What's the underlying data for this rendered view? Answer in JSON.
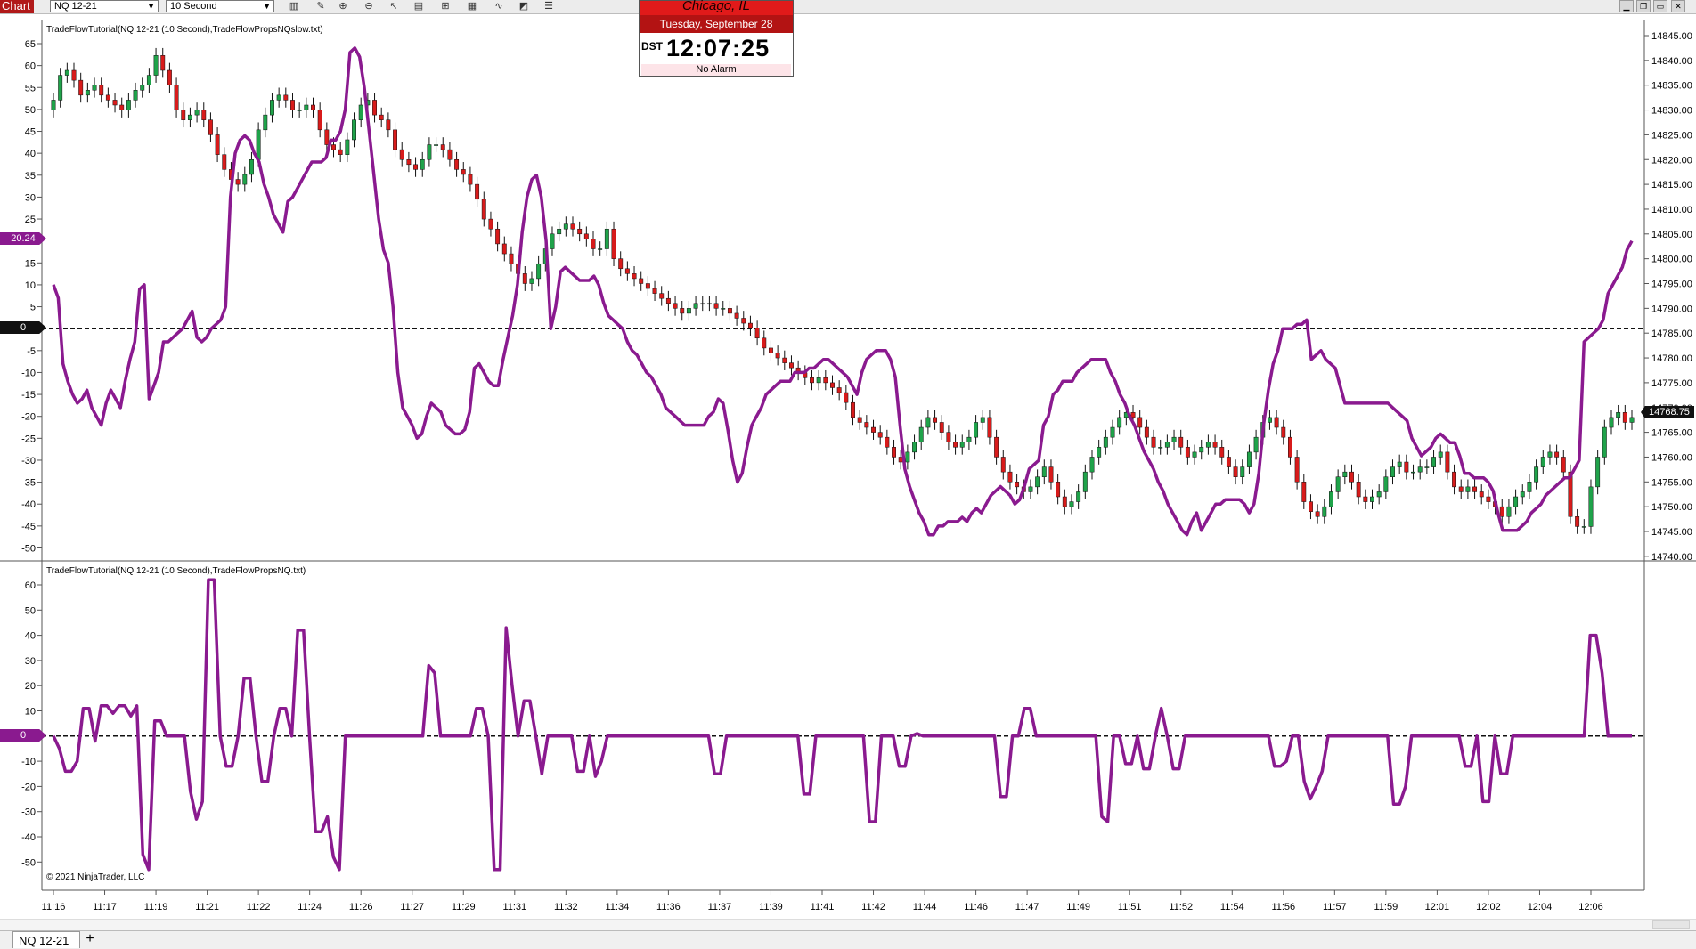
{
  "toolbar": {
    "chart_label": "Chart",
    "instrument": "NQ 12-21",
    "interval": "10 Second",
    "icons": [
      "bars-icon",
      "pencil-icon",
      "zoom-in-icon",
      "zoom-out-icon",
      "pointer-icon",
      "data-box-icon",
      "properties-icon",
      "strategies-icon",
      "indicators-icon",
      "drawing-objects-icon",
      "list-icon"
    ]
  },
  "clock": {
    "city": "Chicago, IL",
    "date": "Tuesday, September 28",
    "dst": "DST",
    "time": "12:07:25",
    "alarm": "No Alarm"
  },
  "panel1": {
    "title": "TradeFlowTutorial(NQ 12-21 (10 Second),TradeFlowPropsNQslow.txt)",
    "left_ticks": [
      "65",
      "60",
      "55",
      "50",
      "45",
      "40",
      "35",
      "30",
      "25",
      "20",
      "15",
      "10",
      "5",
      "0",
      "-5",
      "-10",
      "-15",
      "-20",
      "-25",
      "-30",
      "-35",
      "-40",
      "-45",
      "-50"
    ],
    "right_ticks": [
      "14845.00",
      "14840.00",
      "14835.00",
      "14830.00",
      "14825.00",
      "14820.00",
      "14815.00",
      "14810.00",
      "14805.00",
      "14800.00",
      "14795.00",
      "14790.00",
      "14785.00",
      "14780.00",
      "14775.00",
      "14770.00",
      "14765.00",
      "14760.00",
      "14755.00",
      "14750.00",
      "14745.00",
      "14740.00"
    ],
    "indicator_tag": "20.24",
    "zero_tag": "0",
    "price_tag": "14768.75"
  },
  "panel2": {
    "title": "TradeFlowTutorial(NQ 12-21 (10 Second),TradeFlowPropsNQ.txt)",
    "left_ticks": [
      "60",
      "50",
      "40",
      "30",
      "20",
      "10",
      "0",
      "-10",
      "-20",
      "-30",
      "-40",
      "-50"
    ],
    "zero_tag": "0",
    "copyright": "© 2021 NinjaTrader, LLC"
  },
  "time_axis": [
    "11:16",
    "11:17",
    "11:19",
    "11:21",
    "11:22",
    "11:24",
    "11:26",
    "11:27",
    "11:29",
    "11:31",
    "11:32",
    "11:34",
    "11:36",
    "11:37",
    "11:39",
    "11:41",
    "11:42",
    "11:44",
    "11:46",
    "11:47",
    "11:49",
    "11:51",
    "11:52",
    "11:54",
    "11:56",
    "11:57",
    "11:59",
    "12:01",
    "12:02",
    "12:04",
    "12:06"
  ],
  "bottom_tabs": {
    "tab": "NQ 12-21",
    "add": "+"
  },
  "colors": {
    "up": "#1fa34a",
    "down": "#d81b1b",
    "indicator": "#8a1a8f",
    "accent": "#b11a1a"
  },
  "chart_data": [
    {
      "type": "line",
      "name": "TradeFlowPropsNQslow",
      "y_range": [
        -52,
        67
      ],
      "x_range": [
        "11:16",
        "12:06"
      ],
      "values": [
        10,
        7,
        -8,
        -12,
        -15,
        -17,
        -16,
        -14,
        -18,
        -20,
        -22,
        -17,
        -14,
        -16,
        -18,
        -12,
        -7,
        -3,
        9,
        10,
        -16,
        -13,
        -10,
        -3,
        -3,
        -2,
        -1,
        0,
        2,
        4,
        -2,
        -3,
        -2,
        0,
        1,
        2,
        5,
        30,
        40,
        43,
        44,
        43,
        40,
        38,
        33,
        30,
        26,
        24,
        22,
        29,
        30,
        32,
        34,
        36,
        38,
        38,
        38,
        39,
        43,
        43,
        45,
        50,
        63,
        64,
        62,
        55,
        45,
        35,
        25,
        18,
        15,
        5,
        -10,
        -18,
        -20,
        -22,
        -25,
        -24,
        -20,
        -17,
        -18,
        -19,
        -22,
        -23,
        -24,
        -24,
        -23,
        -19,
        -9,
        -8,
        -10,
        -12,
        -13,
        -13,
        -7,
        -2,
        3,
        10,
        22,
        30,
        34,
        35,
        30,
        20,
        0,
        5,
        13,
        14,
        13,
        12,
        11,
        11,
        11,
        12,
        10,
        6,
        3,
        2,
        1,
        0,
        -3,
        -5,
        -6,
        -8,
        -10,
        -11,
        -13,
        -15,
        -18,
        -19,
        -20,
        -21,
        -22,
        -22,
        -22,
        -22,
        -22,
        -20,
        -19,
        -16,
        -17,
        -23,
        -30,
        -35,
        -33,
        -27,
        -22,
        -20,
        -18,
        -15,
        -14,
        -13,
        -12,
        -12,
        -12,
        -10,
        -10,
        -10,
        -9,
        -9,
        -8,
        -7,
        -7,
        -8,
        -9,
        -10,
        -11,
        -13,
        -15,
        -10,
        -7,
        -6,
        -5,
        -5,
        -5,
        -7,
        -11,
        -22,
        -32,
        -36,
        -39,
        -42,
        -44,
        -47,
        -47,
        -45,
        -45,
        -44,
        -44,
        -44,
        -43,
        -44,
        -42,
        -41,
        -42,
        -40,
        -38,
        -37,
        -36,
        -37,
        -38,
        -40,
        -39,
        -36,
        -32,
        -31,
        -30,
        -22,
        -20,
        -15,
        -14,
        -12,
        -12,
        -12,
        -10,
        -9,
        -8,
        -7,
        -7,
        -7,
        -7,
        -10,
        -12,
        -15,
        -17,
        -20,
        -22,
        -25,
        -28,
        -30,
        -32,
        -35,
        -37,
        -40,
        -42,
        -44,
        -46,
        -47,
        -44,
        -42,
        -46,
        -44,
        -42,
        -40,
        -40,
        -39,
        -39,
        -39,
        -39,
        -40,
        -42,
        -40,
        -33,
        -22,
        -14,
        -8,
        -5,
        0,
        0,
        0,
        1,
        1,
        2,
        -7,
        -6,
        -5,
        -7,
        -8,
        -9,
        -13,
        -17,
        -17,
        -17,
        -17,
        -17,
        -17,
        -17,
        -17,
        -17,
        -17,
        -18,
        -19,
        -20,
        -21,
        -25,
        -27,
        -29,
        -28,
        -27,
        -25,
        -24,
        -25,
        -26,
        -26,
        -29,
        -33,
        -33,
        -34,
        -34,
        -34,
        -35,
        -37,
        -42,
        -46,
        -46,
        -46,
        -46,
        -45,
        -44,
        -42,
        -41,
        -40,
        -38,
        -37,
        -36,
        -35,
        -34,
        -34,
        -32,
        -30,
        -3,
        -2,
        -1,
        0,
        2,
        8,
        10,
        12,
        14,
        18,
        20
      ]
    },
    {
      "type": "candlestick",
      "name": "NQ 12-21 (10 Second)",
      "y_range": [
        14738,
        14847
      ],
      "axis": "right",
      "closes": [
        14832,
        14837,
        14838,
        14836,
        14833,
        14834,
        14835,
        14833,
        14832,
        14831,
        14830,
        14832,
        14834,
        14835,
        14837,
        14841,
        14838,
        14835,
        14830,
        14828,
        14829,
        14830,
        14828,
        14825,
        14821,
        14818,
        14816,
        14815,
        14817,
        14820,
        14826,
        14829,
        14832,
        14833,
        14832,
        14830,
        14830,
        14831,
        14830,
        14826,
        14823,
        14822,
        14821,
        14824,
        14828,
        14831,
        14832,
        14829,
        14828,
        14826,
        14822,
        14820,
        14819,
        14818,
        14820,
        14823,
        14823,
        14822,
        14820,
        14818,
        14817,
        14815,
        14812,
        14808,
        14806,
        14803,
        14801,
        14799,
        14797,
        14795,
        14796,
        14799,
        14802,
        14805,
        14806,
        14807,
        14806,
        14805,
        14804,
        14802,
        14802,
        14806,
        14800,
        14798,
        14797,
        14796,
        14795,
        14794,
        14793,
        14792,
        14791,
        14790,
        14789,
        14790,
        14791,
        14791,
        14791,
        14790,
        14790,
        14789,
        14788,
        14787,
        14786,
        14784,
        14782,
        14781,
        14780,
        14779,
        14778,
        14777,
        14776,
        14775,
        14776,
        14775,
        14774,
        14773,
        14771,
        14768,
        14767,
        14766,
        14765,
        14764,
        14762,
        14760,
        14759,
        14761,
        14763,
        14766,
        14768,
        14767,
        14765,
        14763,
        14762,
        14763,
        14764,
        14767,
        14768,
        14764,
        14760,
        14757,
        14755,
        14754,
        14753,
        14754,
        14756,
        14758,
        14755,
        14752,
        14750,
        14751,
        14753,
        14757,
        14760,
        14762,
        14764,
        14766,
        14768,
        14769,
        14768,
        14766,
        14764,
        14762,
        14762,
        14763,
        14764,
        14762,
        14760,
        14761,
        14762,
        14763,
        14762,
        14760,
        14758,
        14756,
        14758,
        14761,
        14764,
        14767,
        14768,
        14766,
        14764,
        14760,
        14755,
        14751,
        14749,
        14748,
        14750,
        14753,
        14756,
        14757,
        14755,
        14752,
        14751,
        14752,
        14753,
        14756,
        14758,
        14759,
        14757,
        14757,
        14758,
        14758,
        14760,
        14761,
        14757,
        14754,
        14753,
        14754,
        14753,
        14752,
        14751,
        14750,
        14748,
        14750,
        14752,
        14753,
        14755,
        14758,
        14760,
        14761,
        14760,
        14757,
        14748,
        14746,
        14746,
        14754,
        14760,
        14766,
        14768,
        14769,
        14767,
        14768
      ]
    },
    {
      "type": "line",
      "name": "TradeFlowPropsNQ",
      "y_range": [
        -55,
        65
      ],
      "x_range": [
        "11:16",
        "12:06"
      ],
      "values": [
        0,
        -5,
        -14,
        -14,
        -10,
        11,
        11,
        -2,
        12,
        12,
        9,
        12,
        12,
        8,
        12,
        -47,
        -53,
        6,
        6,
        0,
        0,
        0,
        0,
        -22,
        -33,
        -26,
        62,
        62,
        0,
        -12,
        -12,
        0,
        23,
        23,
        0,
        -18,
        -18,
        0,
        11,
        11,
        0,
        42,
        42,
        0,
        -38,
        -38,
        -32,
        -48,
        -53,
        0,
        0,
        0,
        0,
        0,
        0,
        0,
        0,
        0,
        0,
        0,
        0,
        0,
        0,
        28,
        25,
        0,
        0,
        0,
        0,
        0,
        0,
        11,
        11,
        0,
        -53,
        -53,
        43,
        20,
        0,
        14,
        14,
        0,
        -15,
        0,
        0,
        0,
        0,
        0,
        -14,
        -14,
        0,
        -16,
        -10,
        0,
        0,
        0,
        0,
        0,
        0,
        0,
        0,
        0,
        0,
        0,
        0,
        0,
        0,
        0,
        0,
        0,
        0,
        -15,
        -15,
        0,
        0,
        0,
        0,
        0,
        0,
        0,
        0,
        0,
        0,
        0,
        0,
        0,
        -23,
        -23,
        0,
        0,
        0,
        0,
        0,
        0,
        0,
        0,
        0,
        -34,
        -34,
        0,
        0,
        0,
        -12,
        -12,
        0,
        1,
        0,
        0,
        0,
        0,
        0,
        0,
        0,
        0,
        0,
        0,
        0,
        0,
        0,
        -24,
        -24,
        0,
        0,
        11,
        11,
        0,
        0,
        0,
        0,
        0,
        0,
        0,
        0,
        0,
        0,
        0,
        -32,
        -34,
        0,
        0,
        -11,
        -11,
        0,
        -13,
        -13,
        0,
        11,
        0,
        -13,
        -13,
        0,
        0,
        0,
        0,
        0,
        0,
        0,
        0,
        0,
        0,
        0,
        0,
        0,
        0,
        0,
        -12,
        -12,
        -10,
        0,
        0,
        -18,
        -25,
        -20,
        -14,
        0,
        0,
        0,
        0,
        0,
        0,
        0,
        0,
        0,
        0,
        0,
        -27,
        -27,
        -20,
        0,
        0,
        0,
        0,
        0,
        0,
        0,
        0,
        0,
        -12,
        -12,
        0,
        -26,
        -26,
        0,
        -15,
        -15,
        0,
        0,
        0,
        0,
        0,
        0,
        0,
        0,
        0,
        0,
        0,
        0,
        0,
        40,
        40,
        25,
        0,
        0,
        0,
        0,
        0
      ]
    }
  ]
}
